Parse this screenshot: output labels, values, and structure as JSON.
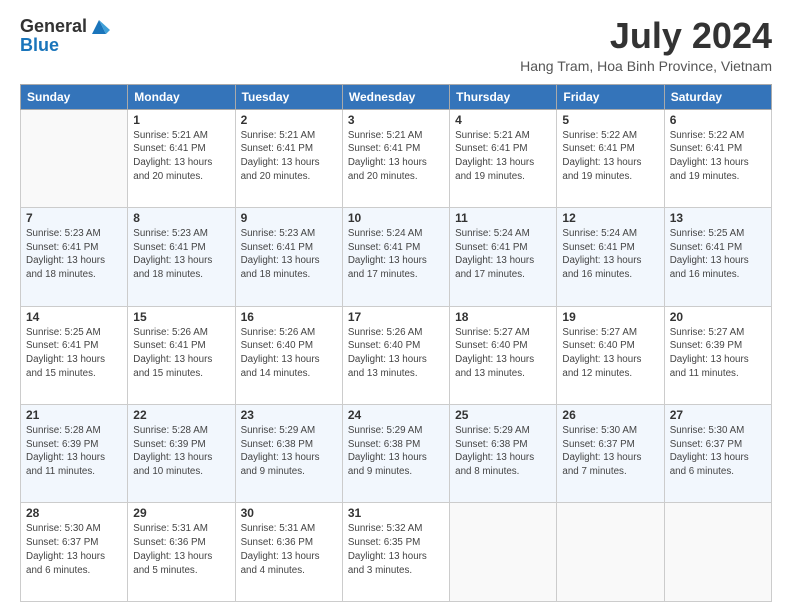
{
  "header": {
    "logo_general": "General",
    "logo_blue": "Blue",
    "month_year": "July 2024",
    "location": "Hang Tram, Hoa Binh Province, Vietnam"
  },
  "weekdays": [
    "Sunday",
    "Monday",
    "Tuesday",
    "Wednesday",
    "Thursday",
    "Friday",
    "Saturday"
  ],
  "weeks": [
    [
      {
        "day": "",
        "info": ""
      },
      {
        "day": "1",
        "info": "Sunrise: 5:21 AM\nSunset: 6:41 PM\nDaylight: 13 hours\nand 20 minutes."
      },
      {
        "day": "2",
        "info": "Sunrise: 5:21 AM\nSunset: 6:41 PM\nDaylight: 13 hours\nand 20 minutes."
      },
      {
        "day": "3",
        "info": "Sunrise: 5:21 AM\nSunset: 6:41 PM\nDaylight: 13 hours\nand 20 minutes."
      },
      {
        "day": "4",
        "info": "Sunrise: 5:21 AM\nSunset: 6:41 PM\nDaylight: 13 hours\nand 19 minutes."
      },
      {
        "day": "5",
        "info": "Sunrise: 5:22 AM\nSunset: 6:41 PM\nDaylight: 13 hours\nand 19 minutes."
      },
      {
        "day": "6",
        "info": "Sunrise: 5:22 AM\nSunset: 6:41 PM\nDaylight: 13 hours\nand 19 minutes."
      }
    ],
    [
      {
        "day": "7",
        "info": "Sunrise: 5:23 AM\nSunset: 6:41 PM\nDaylight: 13 hours\nand 18 minutes."
      },
      {
        "day": "8",
        "info": "Sunrise: 5:23 AM\nSunset: 6:41 PM\nDaylight: 13 hours\nand 18 minutes."
      },
      {
        "day": "9",
        "info": "Sunrise: 5:23 AM\nSunset: 6:41 PM\nDaylight: 13 hours\nand 18 minutes."
      },
      {
        "day": "10",
        "info": "Sunrise: 5:24 AM\nSunset: 6:41 PM\nDaylight: 13 hours\nand 17 minutes."
      },
      {
        "day": "11",
        "info": "Sunrise: 5:24 AM\nSunset: 6:41 PM\nDaylight: 13 hours\nand 17 minutes."
      },
      {
        "day": "12",
        "info": "Sunrise: 5:24 AM\nSunset: 6:41 PM\nDaylight: 13 hours\nand 16 minutes."
      },
      {
        "day": "13",
        "info": "Sunrise: 5:25 AM\nSunset: 6:41 PM\nDaylight: 13 hours\nand 16 minutes."
      }
    ],
    [
      {
        "day": "14",
        "info": "Sunrise: 5:25 AM\nSunset: 6:41 PM\nDaylight: 13 hours\nand 15 minutes."
      },
      {
        "day": "15",
        "info": "Sunrise: 5:26 AM\nSunset: 6:41 PM\nDaylight: 13 hours\nand 15 minutes."
      },
      {
        "day": "16",
        "info": "Sunrise: 5:26 AM\nSunset: 6:40 PM\nDaylight: 13 hours\nand 14 minutes."
      },
      {
        "day": "17",
        "info": "Sunrise: 5:26 AM\nSunset: 6:40 PM\nDaylight: 13 hours\nand 13 minutes."
      },
      {
        "day": "18",
        "info": "Sunrise: 5:27 AM\nSunset: 6:40 PM\nDaylight: 13 hours\nand 13 minutes."
      },
      {
        "day": "19",
        "info": "Sunrise: 5:27 AM\nSunset: 6:40 PM\nDaylight: 13 hours\nand 12 minutes."
      },
      {
        "day": "20",
        "info": "Sunrise: 5:27 AM\nSunset: 6:39 PM\nDaylight: 13 hours\nand 11 minutes."
      }
    ],
    [
      {
        "day": "21",
        "info": "Sunrise: 5:28 AM\nSunset: 6:39 PM\nDaylight: 13 hours\nand 11 minutes."
      },
      {
        "day": "22",
        "info": "Sunrise: 5:28 AM\nSunset: 6:39 PM\nDaylight: 13 hours\nand 10 minutes."
      },
      {
        "day": "23",
        "info": "Sunrise: 5:29 AM\nSunset: 6:38 PM\nDaylight: 13 hours\nand 9 minutes."
      },
      {
        "day": "24",
        "info": "Sunrise: 5:29 AM\nSunset: 6:38 PM\nDaylight: 13 hours\nand 9 minutes."
      },
      {
        "day": "25",
        "info": "Sunrise: 5:29 AM\nSunset: 6:38 PM\nDaylight: 13 hours\nand 8 minutes."
      },
      {
        "day": "26",
        "info": "Sunrise: 5:30 AM\nSunset: 6:37 PM\nDaylight: 13 hours\nand 7 minutes."
      },
      {
        "day": "27",
        "info": "Sunrise: 5:30 AM\nSunset: 6:37 PM\nDaylight: 13 hours\nand 6 minutes."
      }
    ],
    [
      {
        "day": "28",
        "info": "Sunrise: 5:30 AM\nSunset: 6:37 PM\nDaylight: 13 hours\nand 6 minutes."
      },
      {
        "day": "29",
        "info": "Sunrise: 5:31 AM\nSunset: 6:36 PM\nDaylight: 13 hours\nand 5 minutes."
      },
      {
        "day": "30",
        "info": "Sunrise: 5:31 AM\nSunset: 6:36 PM\nDaylight: 13 hours\nand 4 minutes."
      },
      {
        "day": "31",
        "info": "Sunrise: 5:32 AM\nSunset: 6:35 PM\nDaylight: 13 hours\nand 3 minutes."
      },
      {
        "day": "",
        "info": ""
      },
      {
        "day": "",
        "info": ""
      },
      {
        "day": "",
        "info": ""
      }
    ]
  ]
}
